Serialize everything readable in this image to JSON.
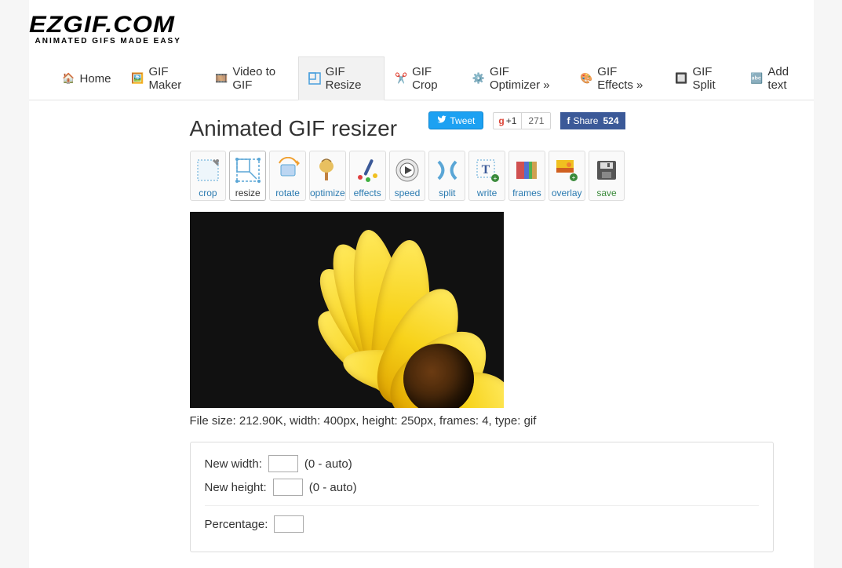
{
  "logo": {
    "main": "EZGIF.COM",
    "sub": "ANIMATED GIFS MADE EASY"
  },
  "nav": {
    "home": "Home",
    "maker": "GIF Maker",
    "video": "Video to GIF",
    "resize": "GIF Resize",
    "crop": "GIF Crop",
    "optimizer": "GIF Optimizer »",
    "effects": "GIF Effects »",
    "split": "GIF Split",
    "addtext": "Add text"
  },
  "page_title": "Animated GIF resizer",
  "share": {
    "tweet": "Tweet",
    "gplus_label": "+1",
    "gplus_count": "271",
    "fb_label": "Share",
    "fb_count": "524"
  },
  "toolbar": {
    "crop": "crop",
    "resize": "resize",
    "rotate": "rotate",
    "optimize": "optimize",
    "effects": "effects",
    "speed": "speed",
    "split": "split",
    "write": "write",
    "frames": "frames",
    "overlay": "overlay",
    "save": "save"
  },
  "file_info": "File size: 212.90K, width: 400px, height: 250px, frames: 4, type: gif",
  "form": {
    "width_label": "New width:",
    "width_hint": "(0 - auto)",
    "height_label": "New height:",
    "height_hint": "(0 - auto)",
    "percentage_label": "Percentage:"
  }
}
